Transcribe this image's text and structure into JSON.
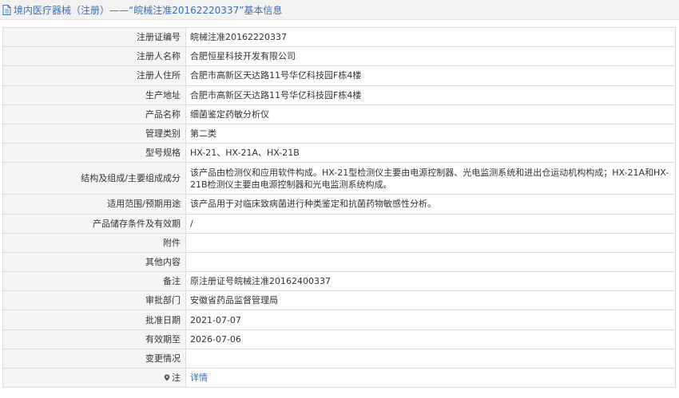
{
  "header": {
    "title": "境内医疗器械（注册）——“皖械注准20162220337”基本信息",
    "icon": "document-icon"
  },
  "rows": [
    {
      "label": "注册证编号",
      "value": "皖械注准20162220337"
    },
    {
      "label": "注册人名称",
      "value": "合肥恒星科技开发有限公司"
    },
    {
      "label": "注册人住所",
      "value": "合肥市高新区天达路11号华亿科技园F栋4楼"
    },
    {
      "label": "生产地址",
      "value": "合肥市高新区天达路11号华亿科技园F栋4楼"
    },
    {
      "label": "产品名称",
      "value": "细菌鉴定药敏分析仪"
    },
    {
      "label": "管理类别",
      "value": "第二类"
    },
    {
      "label": "型号规格",
      "value": "HX-21、HX-21A、HX-21B"
    },
    {
      "label": "结构及组成/主要组成成分",
      "value": "该产品由检测仪和应用软件构成。HX-21型检测仪主要由电源控制器、光电监测系统和进出仓运动机构构成；HX-21A和HX-21B检测仪主要由电源控制器和光电监测系统构成。"
    },
    {
      "label": "适用范围/预期用途",
      "value": "该产品用于对临床致病菌进行种类鉴定和抗菌药物敏感性分析。"
    },
    {
      "label": "产品储存条件及有效期",
      "value": "/"
    },
    {
      "label": "附件",
      "value": ""
    },
    {
      "label": "其他内容",
      "value": ""
    },
    {
      "label": "备注",
      "value": "原注册证号皖械注准20162400337"
    },
    {
      "label": "审批部门",
      "value": "安徽省药品监督管理局"
    },
    {
      "label": "批准日期",
      "value": "2021-07-07"
    },
    {
      "label": "有效期至",
      "value": "2026-07-06"
    },
    {
      "label": "变更情况",
      "value": ""
    },
    {
      "label": "注",
      "value": "详情",
      "icon": "location-pin-icon"
    }
  ],
  "colors": {
    "link": "#3a6eb5",
    "label_bg": "#f5f5f5",
    "border": "#dcdcdc",
    "header_bg": "#f2f2f2"
  }
}
